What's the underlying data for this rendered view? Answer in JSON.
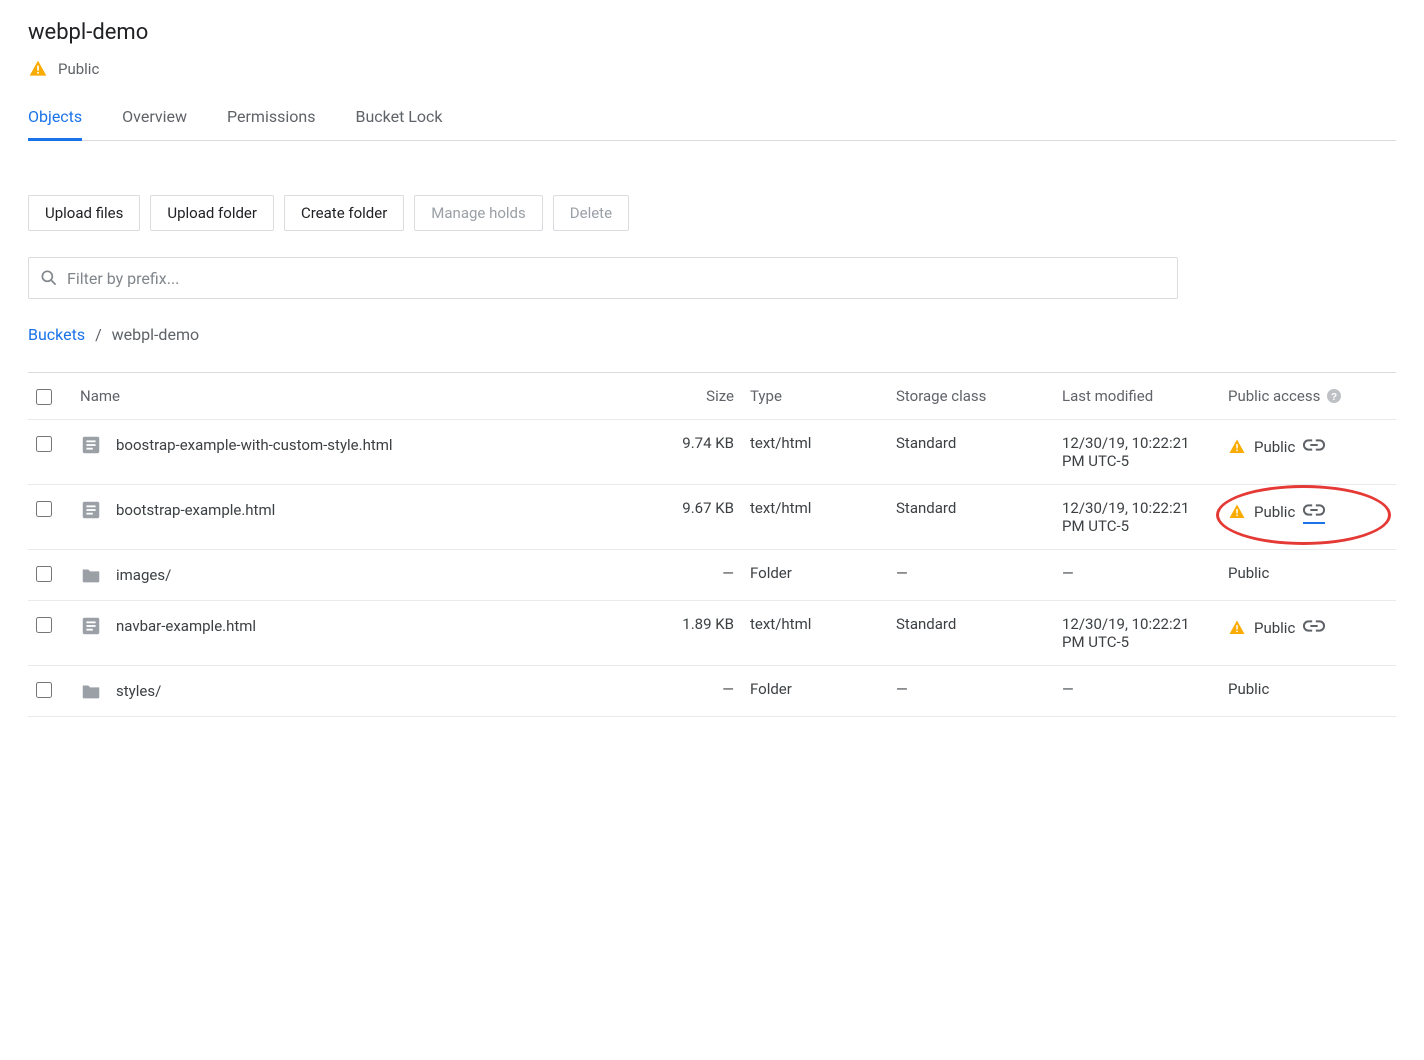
{
  "header": {
    "title": "webpl-demo",
    "access_label": "Public"
  },
  "tabs": [
    {
      "label": "Objects",
      "active": true
    },
    {
      "label": "Overview",
      "active": false
    },
    {
      "label": "Permissions",
      "active": false
    },
    {
      "label": "Bucket Lock",
      "active": false
    }
  ],
  "toolbar": [
    {
      "label": "Upload files",
      "disabled": false
    },
    {
      "label": "Upload folder",
      "disabled": false
    },
    {
      "label": "Create folder",
      "disabled": false
    },
    {
      "label": "Manage holds",
      "disabled": true
    },
    {
      "label": "Delete",
      "disabled": true
    }
  ],
  "filter": {
    "placeholder": "Filter by prefix..."
  },
  "breadcrumb": {
    "root": "Buckets",
    "current": "webpl-demo"
  },
  "columns": {
    "name": "Name",
    "size": "Size",
    "type": "Type",
    "storage": "Storage class",
    "modified": "Last modified",
    "access": "Public access"
  },
  "rows": [
    {
      "kind": "file",
      "name": "boostrap-example-with-custom-style.html",
      "size": "9.74 KB",
      "type": "text/html",
      "storage": "Standard",
      "modified": "12/30/19, 10:22:21 PM UTC-5",
      "access": "Public",
      "warn": true,
      "link": true,
      "highlight": false
    },
    {
      "kind": "file",
      "name": "bootstrap-example.html",
      "size": "9.67 KB",
      "type": "text/html",
      "storage": "Standard",
      "modified": "12/30/19, 10:22:21 PM UTC-5",
      "access": "Public",
      "warn": true,
      "link": true,
      "highlight": true,
      "link_active": true
    },
    {
      "kind": "folder",
      "name": "images/",
      "size": "—",
      "type": "Folder",
      "storage": "—",
      "modified": "—",
      "access": "Public",
      "warn": false,
      "link": false,
      "highlight": false
    },
    {
      "kind": "file",
      "name": "navbar-example.html",
      "size": "1.89 KB",
      "type": "text/html",
      "storage": "Standard",
      "modified": "12/30/19, 10:22:21 PM UTC-5",
      "access": "Public",
      "warn": true,
      "link": true,
      "highlight": false
    },
    {
      "kind": "folder",
      "name": "styles/",
      "size": "—",
      "type": "Folder",
      "storage": "—",
      "modified": "—",
      "access": "Public",
      "warn": false,
      "link": false,
      "highlight": false
    }
  ]
}
